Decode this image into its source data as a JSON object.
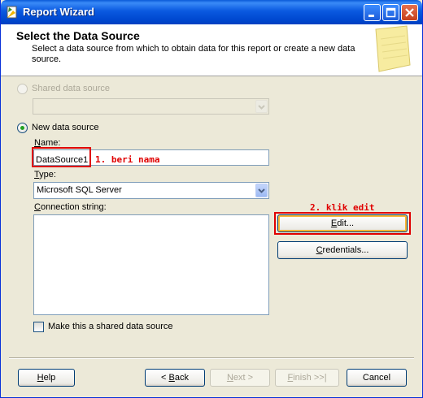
{
  "window": {
    "title": "Report Wizard"
  },
  "header": {
    "title": "Select the Data Source",
    "description": "Select a data source from which to obtain data for this report or create a new data source."
  },
  "shared": {
    "label": "Shared data source"
  },
  "new_source": {
    "label": "New data source",
    "name_label_u": "N",
    "name_label_rest": "ame:",
    "name_value": "DataSource1",
    "type_label_u": "T",
    "type_label_rest": "ype:",
    "type_value": "Microsoft SQL Server",
    "conn_label_u": "C",
    "conn_label_rest": "onnection string:",
    "conn_value": ""
  },
  "buttons": {
    "edit_u": "E",
    "edit_rest": "dit...",
    "credentials_u": "C",
    "credentials_rest": "redentials...",
    "help_u": "H",
    "help_rest": "elp",
    "back_pre": "< ",
    "back_u": "B",
    "back_rest": "ack",
    "next_u": "N",
    "next_rest": "ext >",
    "finish_u": "F",
    "finish_rest": "inish >>|",
    "cancel": "Cancel"
  },
  "shared_checkbox": {
    "label": "Make this a shared data source"
  },
  "annotations": {
    "name_note": "1. beri nama",
    "edit_note": "2. klik edit",
    "color": "#e00000"
  },
  "icons": {
    "app": "report-wizard-icon",
    "wizard": "notepad-icon"
  }
}
